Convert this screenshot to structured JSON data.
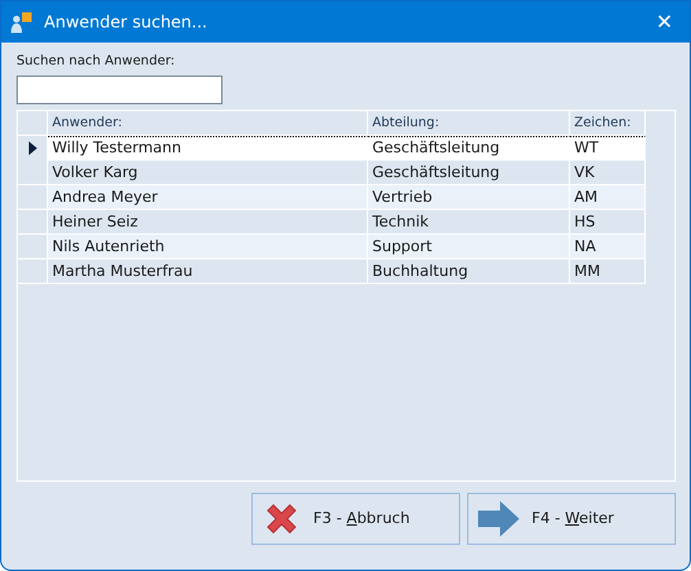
{
  "window": {
    "title": "Anwender suchen...",
    "close": "✕"
  },
  "search": {
    "label": "Suchen nach Anwender:"
  },
  "table": {
    "columns": [
      "Anwender:",
      "Abteilung:",
      "Zeichen:"
    ],
    "rows": [
      {
        "cells": [
          "Willy Testermann",
          "Geschäftsleitung",
          "WT"
        ],
        "selected": true
      },
      {
        "cells": [
          "Volker Karg",
          "Geschäftsleitung",
          "VK"
        ],
        "selected": false
      },
      {
        "cells": [
          "Andrea Meyer",
          "Vertrieb",
          "AM"
        ],
        "selected": false
      },
      {
        "cells": [
          "Heiner Seiz",
          "Technik",
          "HS"
        ],
        "selected": false
      },
      {
        "cells": [
          "Nils Autenrieth",
          "Support",
          "NA"
        ],
        "selected": false
      },
      {
        "cells": [
          "Martha Musterfrau",
          "Buchhaltung",
          "MM"
        ],
        "selected": false
      }
    ]
  },
  "buttons": [
    {
      "kind": "cancel",
      "label_before": "F3 - ",
      "mnemonic": "A",
      "label_after": "bbruch"
    },
    {
      "kind": "next",
      "label_before": "F4 - ",
      "mnemonic": "W",
      "label_after": "eiter"
    }
  ]
}
